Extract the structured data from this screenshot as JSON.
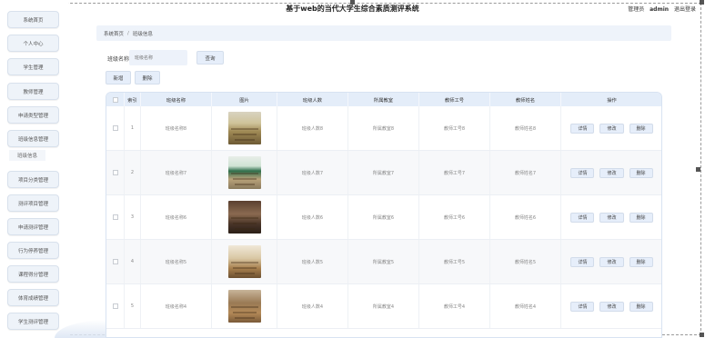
{
  "header": {
    "title": "基于web的当代大学生综合素质测评系统",
    "role": "管理员",
    "username": "admin",
    "logout": "退出登录"
  },
  "sidebar": {
    "items": [
      {
        "label": "系统首页"
      },
      {
        "label": "个人中心"
      },
      {
        "label": "学生管理"
      },
      {
        "label": "教师管理"
      },
      {
        "label": "申请类型管理"
      },
      {
        "label": "班级信息管理"
      },
      {
        "label": "项目分类管理"
      },
      {
        "label": "测评项目管理"
      },
      {
        "label": "申请测评管理"
      },
      {
        "label": "行为停养管理"
      },
      {
        "label": "课程得分管理"
      },
      {
        "label": "体育成绩管理"
      },
      {
        "label": "学生测评管理"
      }
    ],
    "sub_item": "班级信息"
  },
  "breadcrumb": {
    "home": "系统首页",
    "separator": "/",
    "current": "班级信息"
  },
  "search": {
    "label": "班级名称",
    "placeholder": "班级名称",
    "button": "查询"
  },
  "toolbar": {
    "add": "新增",
    "delete": "删除"
  },
  "table": {
    "columns": [
      "索引",
      "班级名称",
      "图片",
      "班级人数",
      "所属教室",
      "教师工号",
      "教师姓名",
      "操作"
    ],
    "rows": [
      {
        "index": "1",
        "name": "班级名称8",
        "count": "班级人数8",
        "room": "所属教室8",
        "teacher_id": "教师工号8",
        "teacher_name": "教师姓名8",
        "photo": "classroom-yellow"
      },
      {
        "index": "2",
        "name": "班级名称7",
        "count": "班级人数7",
        "room": "所属教室7",
        "teacher_id": "教师工号7",
        "teacher_name": "教师姓名7",
        "photo": "classroom-green"
      },
      {
        "index": "3",
        "name": "班级名称6",
        "count": "班级人数6",
        "room": "所属教室6",
        "teacher_id": "教师工号6",
        "teacher_name": "教师姓名6",
        "photo": "classroom-dark"
      },
      {
        "index": "4",
        "name": "班级名称5",
        "count": "班级人数5",
        "room": "所属教室5",
        "teacher_id": "教师工号5",
        "teacher_name": "教师姓名5",
        "photo": "classroom-wood"
      },
      {
        "index": "5",
        "name": "班级名称4",
        "count": "班级人数4",
        "room": "所属教室4",
        "teacher_id": "教师工号4",
        "teacher_name": "教师姓名4",
        "photo": "classroom-rows"
      }
    ],
    "actions": {
      "detail": "详情",
      "edit": "修改",
      "delete": "删除"
    }
  },
  "colors": {
    "accent_light": "#e6eefa",
    "header_bg": "#e4edf9",
    "crumb_bg": "#eef3fa"
  }
}
